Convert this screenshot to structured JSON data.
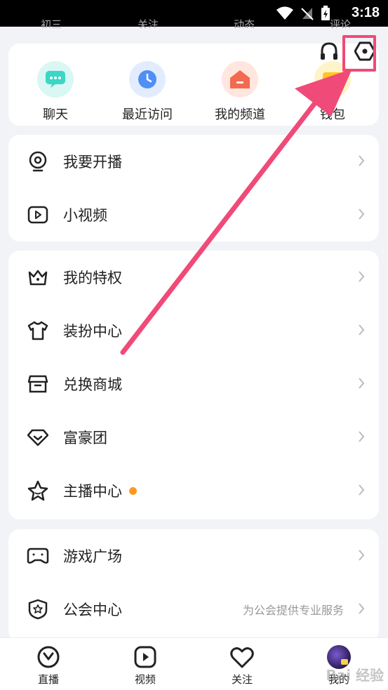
{
  "status": {
    "time": "3:18"
  },
  "ghost_tabs": [
    "初三",
    "关注",
    "动态",
    "评论"
  ],
  "quick_actions": [
    {
      "label": "聊天",
      "icon": "chat-bubble-icon",
      "color": "#3cd6c6"
    },
    {
      "label": "最近访问",
      "icon": "clock-icon",
      "color": "#4f8ff7"
    },
    {
      "label": "我的频道",
      "icon": "house-icon",
      "color": "#f26a4f"
    },
    {
      "label": "钱包",
      "icon": "wallet-icon",
      "color": "#ffc520"
    }
  ],
  "group1": [
    {
      "label": "我要开播",
      "icon": "webcam-icon"
    },
    {
      "label": "小视频",
      "icon": "play-icon"
    }
  ],
  "group2": [
    {
      "label": "我的特权",
      "icon": "crown-icon"
    },
    {
      "label": "装扮中心",
      "icon": "tshirt-icon"
    },
    {
      "label": "兑换商城",
      "icon": "store-icon"
    },
    {
      "label": "富豪团",
      "icon": "diamond-icon"
    },
    {
      "label": "主播中心",
      "icon": "star-icon",
      "badge_dot": true
    }
  ],
  "group3": [
    {
      "label": "游戏广场",
      "icon": "gamepad-icon"
    },
    {
      "label": "公会中心",
      "icon": "shield-star-icon",
      "sub": "为公会提供专业服务"
    }
  ],
  "nav": [
    {
      "label": "直播",
      "icon": "live-icon"
    },
    {
      "label": "视频",
      "icon": "video-icon"
    },
    {
      "label": "关注",
      "icon": "heart-icon"
    },
    {
      "label": "我的",
      "icon": "avatar-icon"
    }
  ],
  "watermark": "Bai 经验",
  "colors": {
    "accent": "#f04a78",
    "dot": "#ff9a1f"
  }
}
